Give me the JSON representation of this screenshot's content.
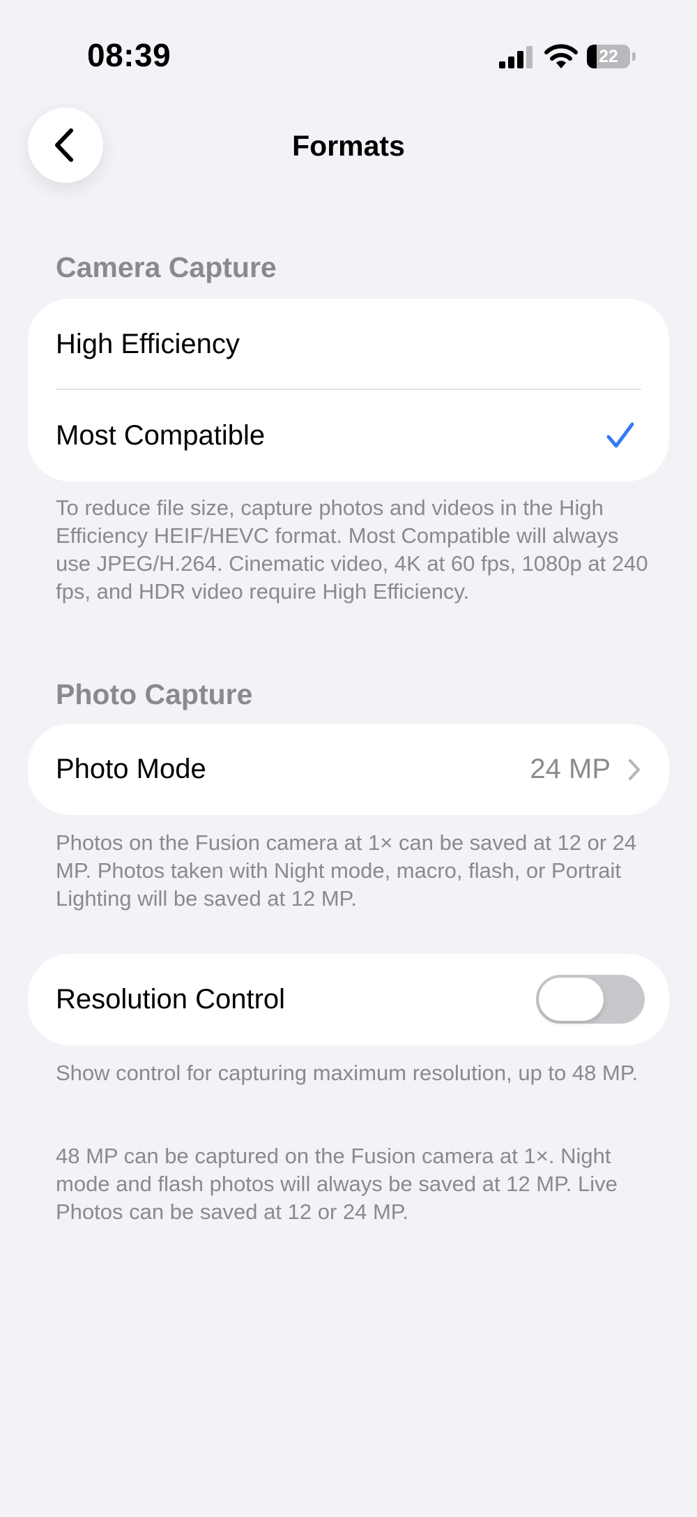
{
  "status_bar": {
    "time": "08:39",
    "battery_level": "22",
    "battery_fraction": 0.22,
    "icons": [
      "signal-icon",
      "wifi-icon",
      "battery-icon"
    ]
  },
  "nav": {
    "title": "Formats",
    "back_icon": "chevron-left-icon"
  },
  "camera_capture": {
    "header": "Camera Capture",
    "options": [
      {
        "label": "High Efficiency",
        "selected": false
      },
      {
        "label": "Most Compatible",
        "selected": true
      }
    ],
    "selected_icon": "checkmark-icon",
    "accent_color": "#3478f6",
    "footnote": "To reduce file size, capture photos and videos in the High Efficiency HEIF/HEVC format. Most Compatible will always use JPEG/H.264. Cinematic video, 4K at 60 fps, 1080p at 240 fps, and HDR video require High Efficiency."
  },
  "photo_capture": {
    "header": "Photo Capture",
    "photo_mode": {
      "label": "Photo Mode",
      "value": "24 MP",
      "icon": "chevron-right-icon"
    },
    "footnote": "Photos on the Fusion camera at 1× can be saved at 12 or 24 MP. Photos taken with Night mode, macro, flash, or Portrait Lighting will be saved at 12 MP."
  },
  "resolution_control": {
    "label": "Resolution Control",
    "enabled": false,
    "footnote_1": "Show control for capturing maximum resolution, up to 48 MP.",
    "footnote_2": "48 MP can be captured on the Fusion camera at 1×. Night mode and flash photos will always be saved at 12 MP. Live Photos can be saved at 12 or 24 MP."
  }
}
